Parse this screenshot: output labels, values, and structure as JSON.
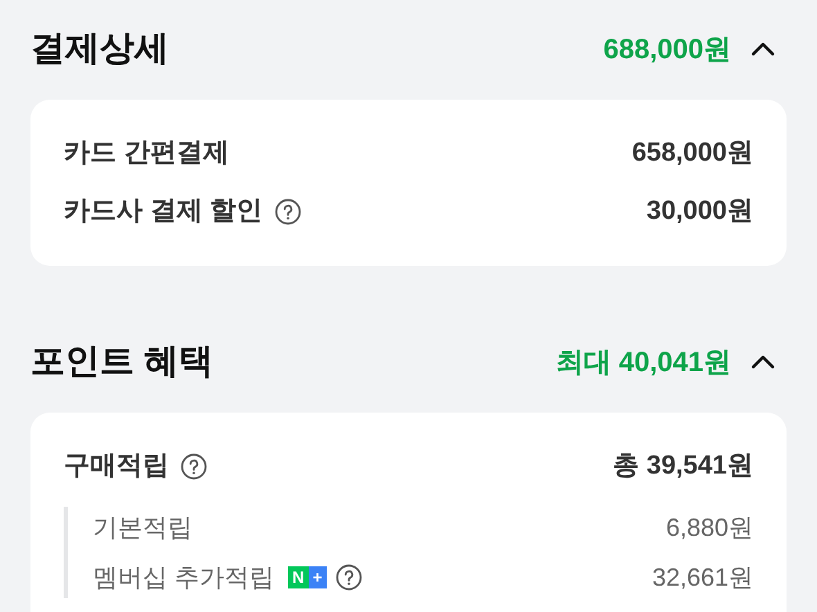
{
  "sections": [
    {
      "title": "결제상세",
      "total": "688,000원",
      "expanded": true,
      "rows": [
        {
          "label": "카드 간편결제",
          "value": "658,000원",
          "help": false
        },
        {
          "label": "카드사 결제 할인",
          "value": "30,000원",
          "help": true
        }
      ]
    },
    {
      "title": "포인트 혜택",
      "total": "최대 40,041원",
      "expanded": true,
      "rows": [
        {
          "label": "구매적립",
          "value": "총 39,541원",
          "help": true,
          "children": [
            {
              "label": "기본적립",
              "value": "6,880원",
              "help": false
            },
            {
              "label": "멤버십 추가적립",
              "value": "32,661원",
              "help": true,
              "badge": [
                {
                  "text": "N",
                  "color": "#03c75a"
                },
                {
                  "text": "+",
                  "color": "#3b82f6"
                }
              ]
            }
          ]
        }
      ]
    }
  ]
}
